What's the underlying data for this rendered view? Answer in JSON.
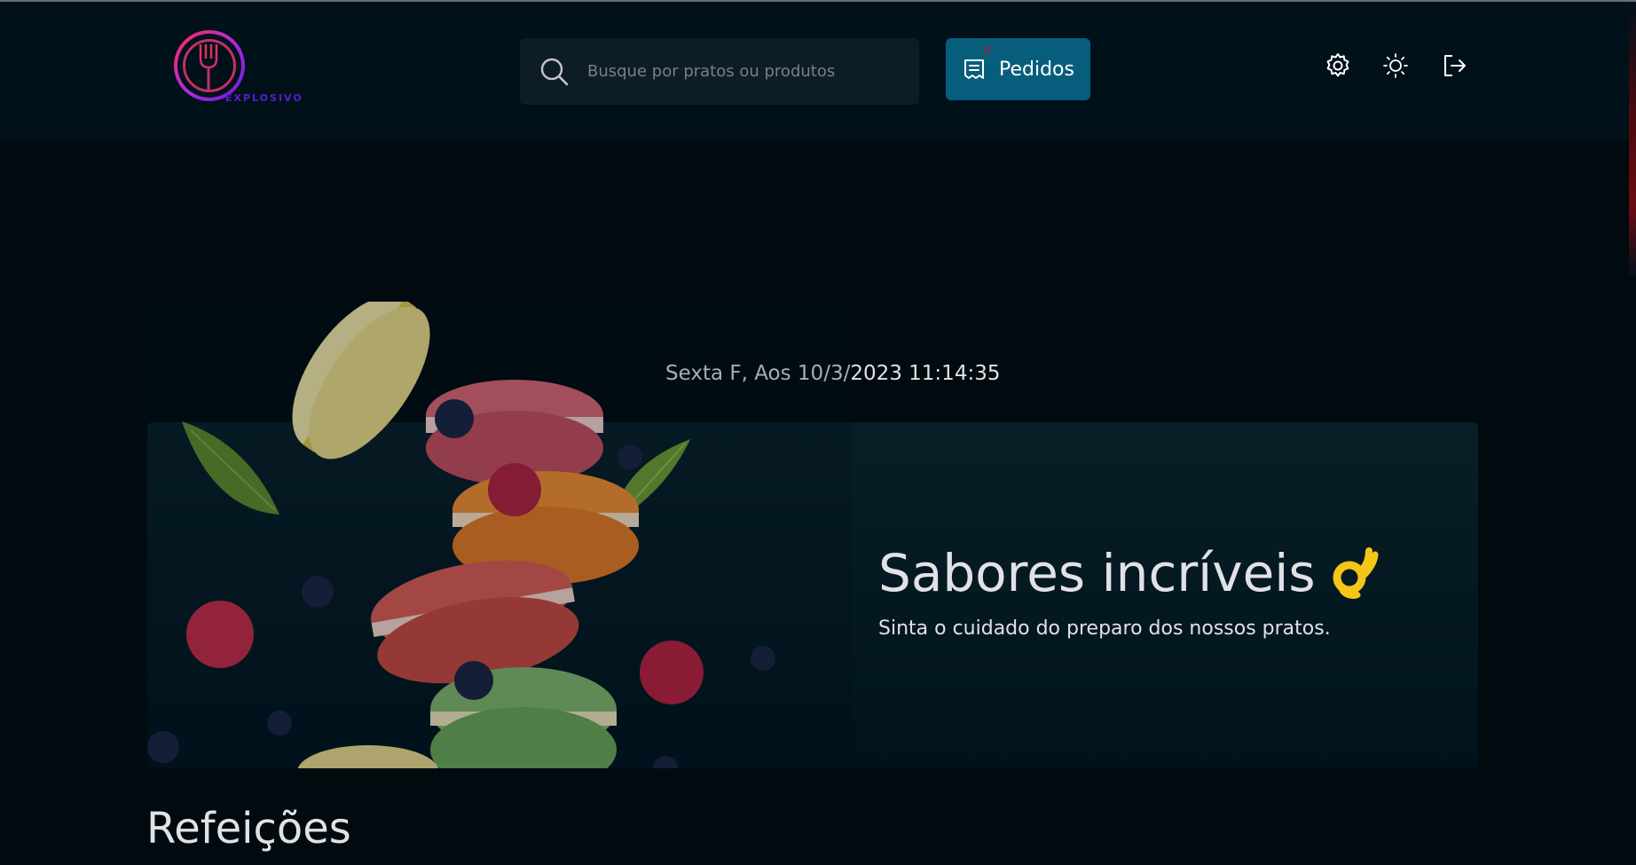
{
  "header": {
    "logo_text": "EXPLOSIVO",
    "search": {
      "placeholder": "Busque por pratos ou produtos",
      "value": ""
    },
    "orders": {
      "label": "Pedidos",
      "count": "0"
    },
    "icons": [
      "gear-icon",
      "sun-icon",
      "sign-out-icon"
    ]
  },
  "datetime": "Sexta F, Aos 10/3/2023 11:14:35",
  "banner": {
    "title": "Sabores incríveis",
    "emoji": "ok-hand-icon",
    "subtitle": "Sinta o cuidado do preparo dos nossos pratos."
  },
  "sections": [
    {
      "title": "Refeições"
    }
  ],
  "colors": {
    "background": "#000a0f",
    "header": "#00111a",
    "banner": "#091e26",
    "orders_button": "#065e7c",
    "orders_count": "#ab222e"
  }
}
